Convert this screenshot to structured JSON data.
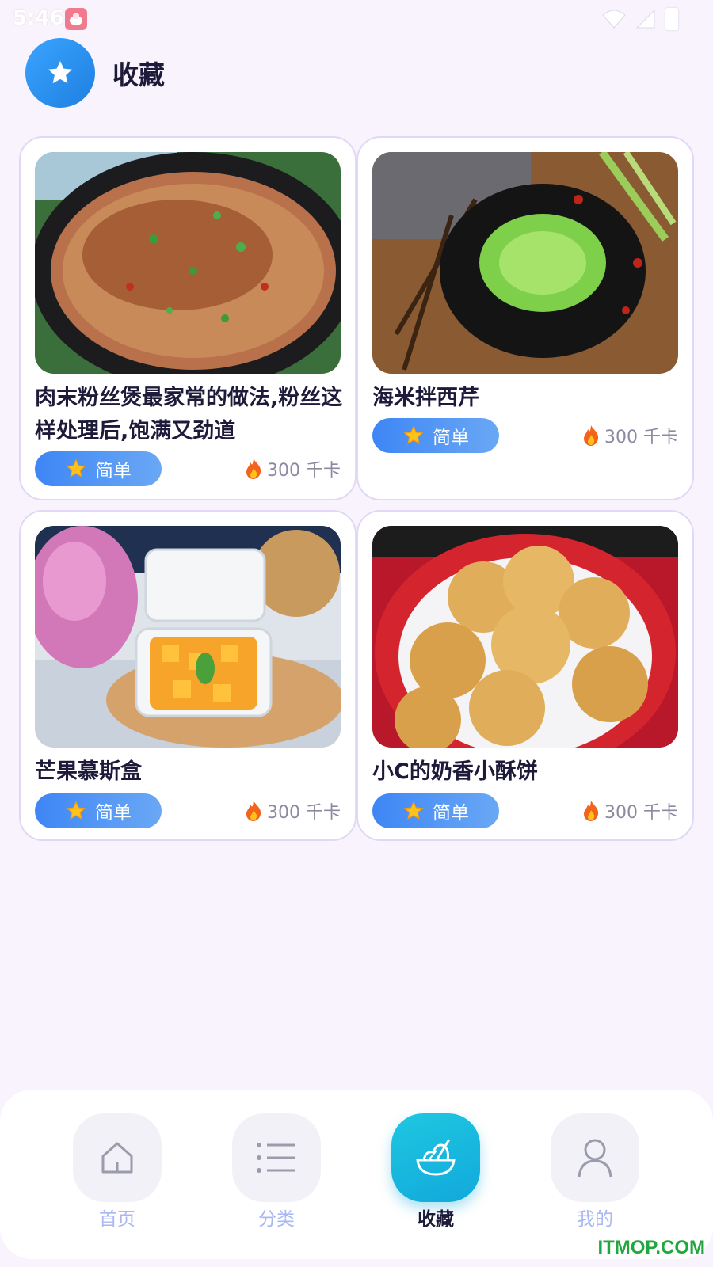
{
  "status_bar": {
    "time": "5:46"
  },
  "header": {
    "title": "收藏",
    "icon": "star-icon"
  },
  "recipes": [
    {
      "title": "肉末粉丝煲最家常的做法,粉丝这样处理后,饱满又劲道",
      "difficulty": "简单",
      "calories": "300 千卡"
    },
    {
      "title": "海米拌西芹",
      "difficulty": "简单",
      "calories": "300 千卡"
    },
    {
      "title": "芒果慕斯盒",
      "difficulty": "简单",
      "calories": "300 千卡"
    },
    {
      "title": "小C的奶香小酥饼",
      "difficulty": "简单",
      "calories": "300 千卡"
    }
  ],
  "bottom_nav": {
    "items": [
      {
        "label": "首页",
        "icon": "home-icon"
      },
      {
        "label": "分类",
        "icon": "list-icon"
      },
      {
        "label": "收藏",
        "icon": "salad-bowl-icon",
        "active": true
      },
      {
        "label": "我的",
        "icon": "user-icon"
      }
    ]
  },
  "watermark": "ITMOP.COM",
  "colors": {
    "accent": "#3e86f5",
    "active_nav": "#11a9dc",
    "background": "#f8f3fd",
    "card_border": "#e0d8f6"
  }
}
